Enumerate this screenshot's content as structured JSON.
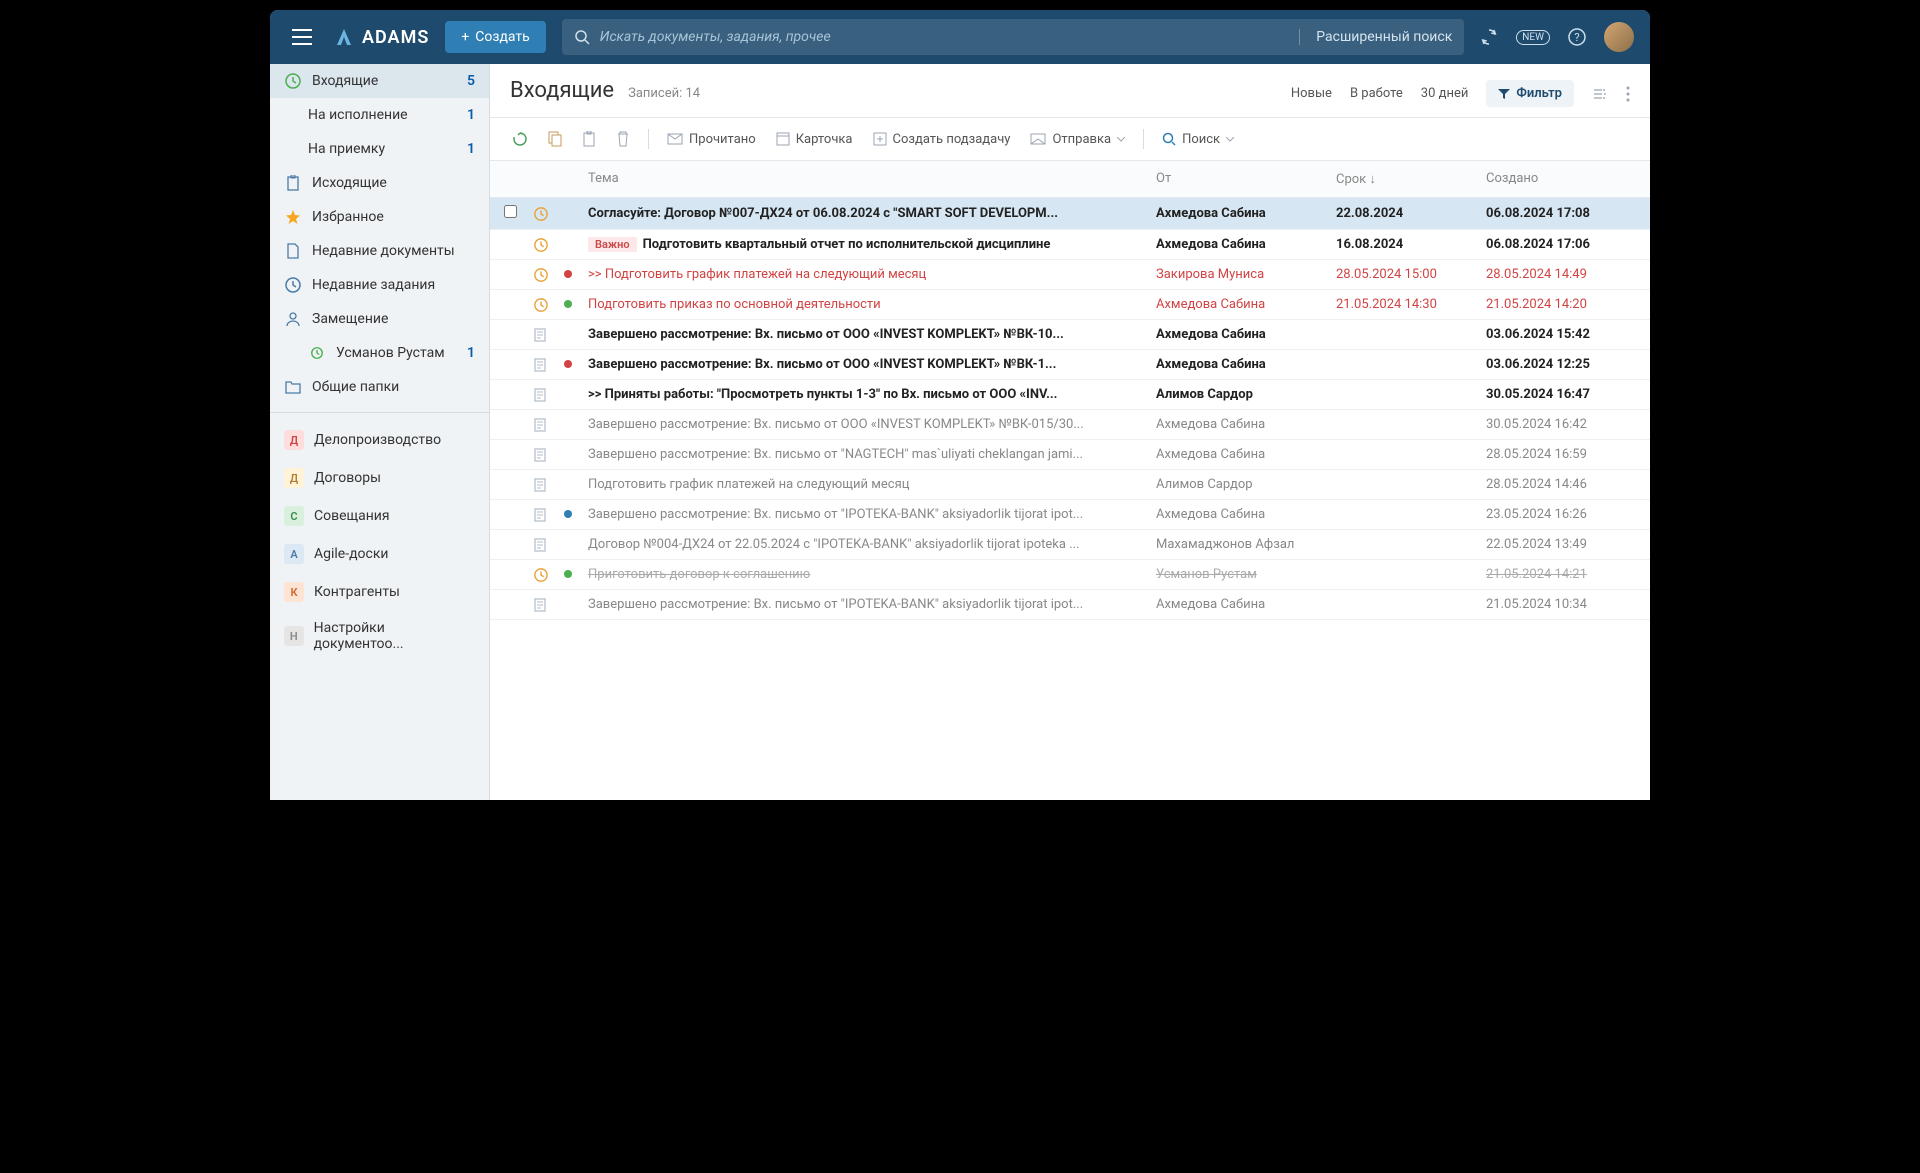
{
  "header": {
    "app_name": "ADAMS",
    "create_label": "Создать",
    "search_placeholder": "Искать документы, задания, прочее",
    "advanced_search": "Расширенный поиск",
    "new_badge": "NEW"
  },
  "sidebar": {
    "folders": [
      {
        "icon": "clock-green",
        "label": "Входящие",
        "count": "5",
        "active": true
      },
      {
        "sub": true,
        "label": "На исполнение",
        "count": "1"
      },
      {
        "sub": true,
        "label": "На приемку",
        "count": "1"
      },
      {
        "icon": "clipboard",
        "label": "Исходящие"
      },
      {
        "icon": "star",
        "label": "Избранное"
      },
      {
        "icon": "doc",
        "label": "Недавние документы"
      },
      {
        "icon": "clock",
        "label": "Недавние задания"
      },
      {
        "icon": "user",
        "label": "Замещение"
      },
      {
        "sub": true,
        "icon": "clock-green-sm",
        "label": "Усманов Рустам",
        "count": "1"
      },
      {
        "icon": "folder",
        "label": "Общие папки"
      }
    ],
    "modules": [
      {
        "letter": "Д",
        "cls": "l-red",
        "label": "Делопроизводство"
      },
      {
        "letter": "Д",
        "cls": "l-yellow",
        "label": "Договоры"
      },
      {
        "letter": "С",
        "cls": "l-green",
        "label": "Совещания"
      },
      {
        "letter": "А",
        "cls": "l-blue",
        "label": "Agile-доски"
      },
      {
        "letter": "К",
        "cls": "l-orange",
        "label": "Контрагенты"
      },
      {
        "letter": "Н",
        "cls": "l-gray",
        "label": "Настройки документоо..."
      }
    ]
  },
  "page": {
    "title": "Входящие",
    "record_count": "Записей: 14",
    "tabs": {
      "new": "Новые",
      "in_work": "В работе",
      "days30": "30 дней",
      "filter": "Фильтр"
    }
  },
  "toolbar": {
    "read": "Прочитано",
    "card": "Карточка",
    "subtask": "Создать подзадачу",
    "send": "Отправка",
    "search": "Поиск"
  },
  "columns": {
    "subject": "Тема",
    "from": "От",
    "due": "Срок",
    "created": "Создано"
  },
  "rows": [
    {
      "icon": "clock",
      "dot": "",
      "subject": "Согласуйте: Договор №007-ДХ24 от 06.08.2024 с \"SMART SOFT DEVELOPM...",
      "from": "Ахмедова Сабина",
      "due": "22.08.2024",
      "created": "06.08.2024 17:08",
      "unread": true,
      "selected": true
    },
    {
      "icon": "clock",
      "dot": "",
      "badge": "Важно",
      "subject": "Подготовить квартальный отчет по исполнительской дисциплине",
      "from": "Ахмедова Сабина",
      "due": "16.08.2024",
      "created": "06.08.2024 17:06",
      "unread": true
    },
    {
      "icon": "clock",
      "dot": "red",
      "subject": ">> Подготовить график платежей на следующий месяц",
      "from": "Закирова Муниса",
      "due": "28.05.2024 15:00",
      "created": "28.05.2024 14:49",
      "overdue": true
    },
    {
      "icon": "clock",
      "dot": "green",
      "subject": "Подготовить приказ по основной деятельности",
      "from": "Ахмедова Сабина",
      "due": "21.05.2024 14:30",
      "created": "21.05.2024 14:20",
      "overdue": true
    },
    {
      "icon": "doc",
      "dot": "",
      "subject": "Завершено рассмотрение: Вх. письмо от ООО «INVEST KOMPLEKT» №ВК-10...",
      "from": "Ахмедова Сабина",
      "due": "",
      "created": "03.06.2024 15:42",
      "unread": true
    },
    {
      "icon": "doc",
      "dot": "red",
      "subject": "Завершено рассмотрение: Вх. письмо от ООО «INVEST KOMPLEKT» №ВК-1...",
      "from": "Ахмедова Сабина",
      "due": "",
      "created": "03.06.2024 12:25",
      "unread": true
    },
    {
      "icon": "doc",
      "dot": "",
      "subject": ">> Приняты работы: \"Просмотреть пункты 1-3\" по Вх. письмо от ООО «INV...",
      "from": "Алимов Сардор",
      "due": "",
      "created": "30.05.2024 16:47",
      "unread": true
    },
    {
      "icon": "doc",
      "dot": "",
      "subject": "Завершено рассмотрение: Вх. письмо от ООО «INVEST KOMPLEKT» №ВК-015/30...",
      "from": "Ахмедова Сабина",
      "due": "",
      "created": "30.05.2024 16:42",
      "read": true
    },
    {
      "icon": "doc",
      "dot": "",
      "subject": "Завершено рассмотрение: Вх. письмо от \"NAGTECH\" mas`uliyati cheklangan jami...",
      "from": "Ахмедова Сабина",
      "due": "",
      "created": "28.05.2024 16:59",
      "read": true
    },
    {
      "icon": "doc",
      "dot": "",
      "subject": "Подготовить график платежей на следующий месяц",
      "from": "Алимов Сардор",
      "due": "",
      "created": "28.05.2024 14:46",
      "read": true
    },
    {
      "icon": "doc",
      "dot": "blue",
      "subject": "Завершено рассмотрение: Вх. письмо от \"IPOTEKA-BANK\" aksiyadorlik tijorat ipot...",
      "from": "Ахмедова Сабина",
      "due": "",
      "created": "23.05.2024 16:26",
      "read": true
    },
    {
      "icon": "doc",
      "dot": "",
      "subject": "Договор №004-ДХ24 от 22.05.2024 с \"IPOTEKA-BANK\" aksiyadorlik tijorat ipoteka ...",
      "from": "Махамаджонов Афзал",
      "due": "",
      "created": "22.05.2024 13:49",
      "read": true
    },
    {
      "icon": "clock",
      "dot": "green",
      "subject": "Приготовить договор к соглашению",
      "from": "Усманов Рустам",
      "due": "",
      "created": "21.05.2024 14:21",
      "strike": true,
      "read": true
    },
    {
      "icon": "doc",
      "dot": "",
      "subject": "Завершено рассмотрение: Вх. письмо от \"IPOTEKA-BANK\" aksiyadorlik tijorat ipot...",
      "from": "Ахмедова Сабина",
      "due": "",
      "created": "21.05.2024 10:34",
      "read": true
    }
  ]
}
